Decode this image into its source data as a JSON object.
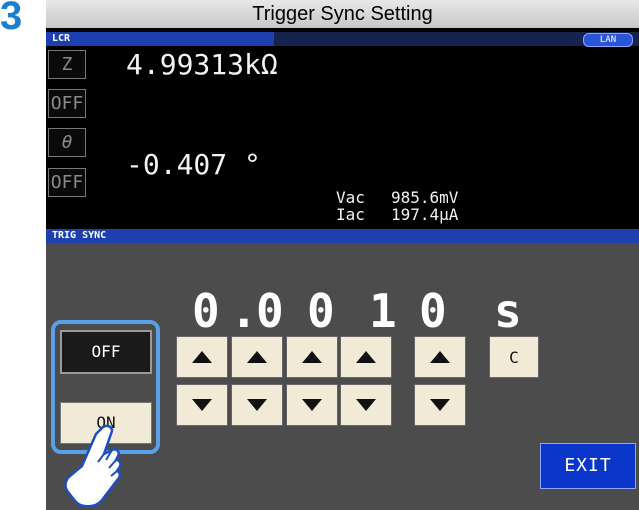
{
  "step_number": "3",
  "title": "Trigger Sync Setting",
  "header": {
    "mode_label": "LCR",
    "lan_badge": "LAN"
  },
  "measurements": {
    "param1": "Z",
    "param1_value": "4.99313kΩ",
    "param2_state": "OFF",
    "param3": "θ",
    "param3_value": "-0.407 °",
    "param4_state": "OFF",
    "vac_label": "Vac",
    "vac_value": "985.6mV",
    "iac_label": "Iac",
    "iac_value": "197.4μA"
  },
  "trig_sync": {
    "section_label": "TRIG SYNC",
    "digits": [
      "0",
      ".",
      "0",
      "0",
      "1",
      "0"
    ],
    "unit": "s",
    "clear_label": "C",
    "off_label": "OFF",
    "on_label": "ON",
    "selected": "OFF",
    "exit_label": "EXIT"
  },
  "colors": {
    "accent_blue": "#1e3fb0",
    "exit_blue": "#0a36c9",
    "highlight": "#5aa0e6",
    "step_blue": "#1a7fd1"
  },
  "icons": [
    "up-arrow-icon",
    "down-arrow-icon",
    "pointing-hand-icon"
  ]
}
